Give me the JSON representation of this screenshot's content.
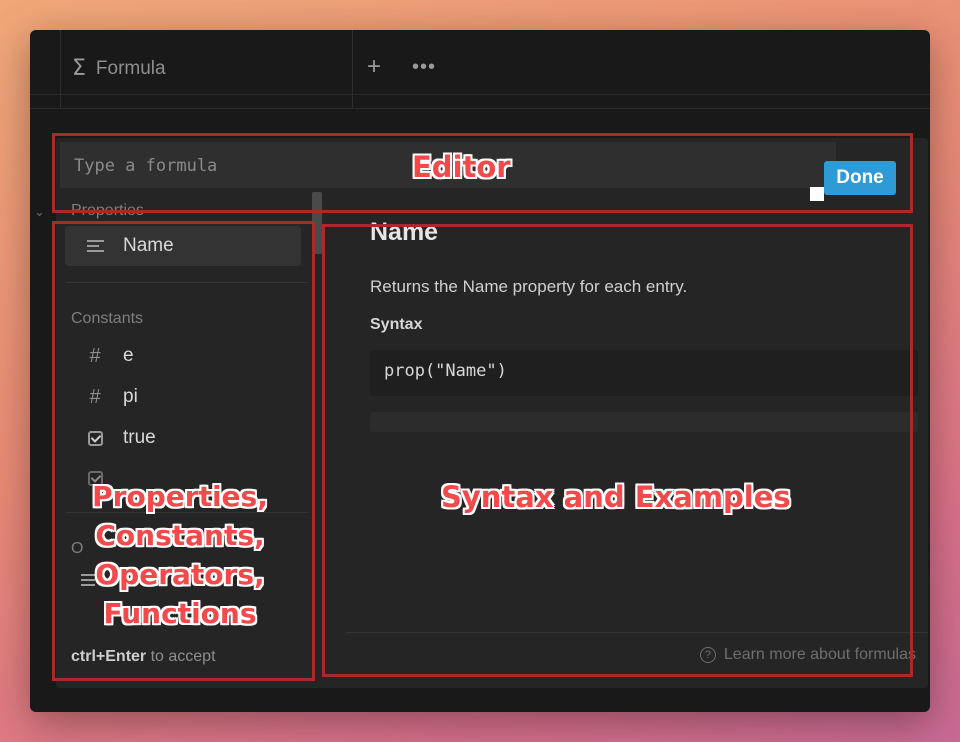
{
  "column_header": {
    "icon": "sigma-icon",
    "title": "Formula",
    "add_symbol": "+",
    "more_symbol": "•••"
  },
  "editor": {
    "placeholder": "Type a formula",
    "value": "",
    "done_label": "Done",
    "done_color": "#2e9bd6"
  },
  "left_panel": {
    "sections": [
      {
        "label": "Properties",
        "items": [
          {
            "label": "Name",
            "icon": "text-lines-icon",
            "selected": true
          }
        ]
      },
      {
        "label": "Constants",
        "items": [
          {
            "label": "e",
            "icon": "hash-icon"
          },
          {
            "label": "pi",
            "icon": "hash-icon"
          },
          {
            "label": "true",
            "icon": "checkbox-icon"
          }
        ]
      }
    ],
    "partial_section_initial": "O",
    "footer_key": "ctrl+Enter",
    "footer_text": "to accept"
  },
  "right_panel": {
    "title": "Name",
    "description": "Returns the Name property for each entry.",
    "syntax_label": "Syntax",
    "syntax_code": "prop(\"Name\")",
    "learn_more": "Learn more about formulas"
  },
  "annotations": {
    "editor": "Editor",
    "left_lines": [
      "Properties,",
      "Constants,",
      "Operators,",
      "Functions"
    ],
    "right": "Syntax and Examples",
    "color": "#a82a2a"
  }
}
